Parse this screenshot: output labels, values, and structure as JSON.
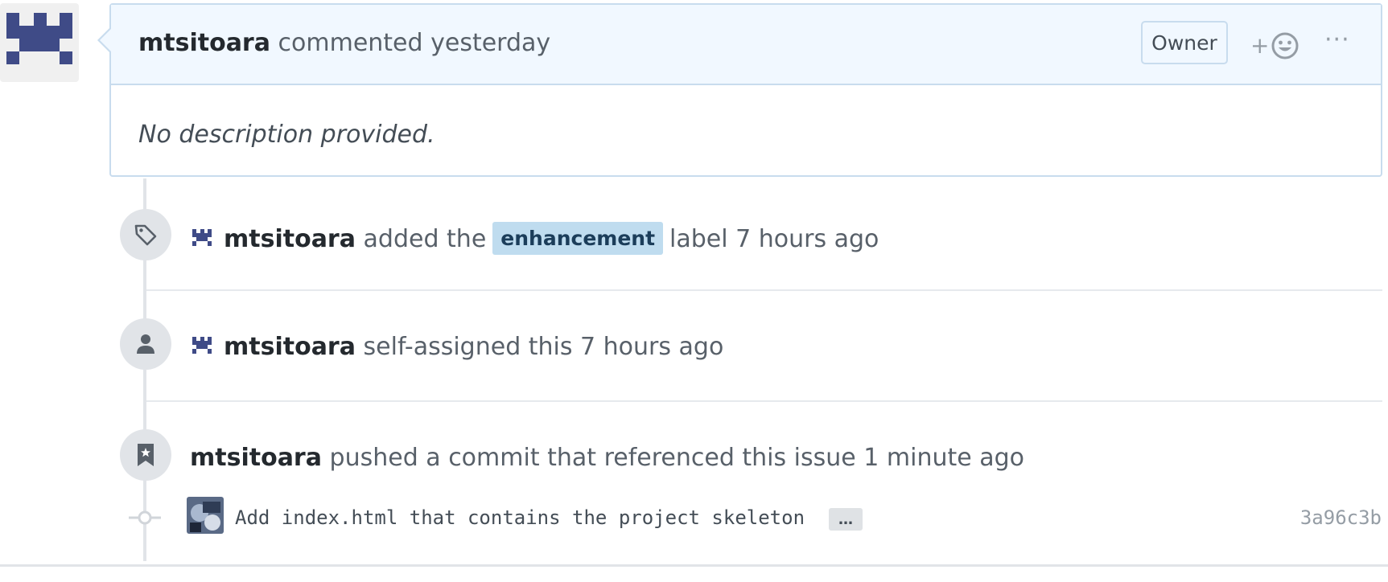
{
  "comment": {
    "author": "mtsitoara",
    "action": "commented",
    "time": "yesterday",
    "role_badge": "Owner",
    "reaction_plus": "+",
    "more": "···",
    "body": "No description provided."
  },
  "events": [
    {
      "icon": "tag-icon",
      "actor": "mtsitoara",
      "pre": "added the",
      "label": "enhancement",
      "post": "label 7 hours ago"
    },
    {
      "icon": "person-icon",
      "actor": "mtsitoara",
      "text": "self-assigned this 7 hours ago"
    },
    {
      "icon": "bookmark-icon",
      "actor": "mtsitoara",
      "text": "pushed a commit that referenced this issue 1 minute ago"
    }
  ],
  "commit": {
    "message": "Add index.html that contains the project skeleton",
    "ellipsis": "…",
    "sha": "3a96c3b"
  },
  "colors": {
    "accent": "#f1f8ff",
    "border": "#c8dcee",
    "label_bg": "#bfdcef",
    "author_avatar": "#3f4b87"
  }
}
